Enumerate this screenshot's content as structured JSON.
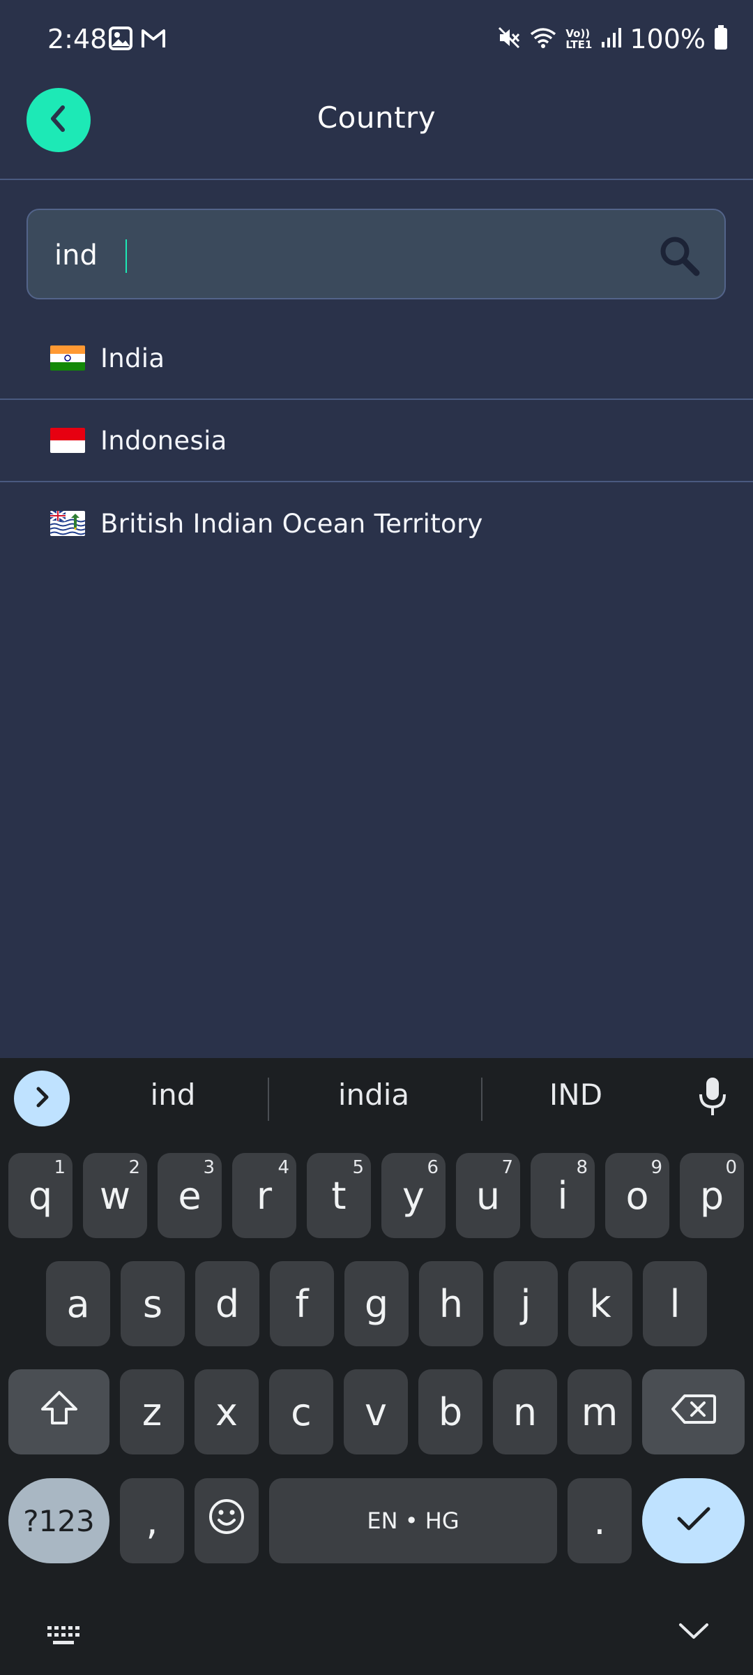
{
  "status_bar": {
    "time": "2:48",
    "battery": "100%",
    "network_label_top": "Vo))",
    "network_label_bottom": "LTE1"
  },
  "header": {
    "title": "Country",
    "accent": "#1de9b6"
  },
  "search": {
    "value": "ind",
    "placeholder": ""
  },
  "results": [
    {
      "label": "India",
      "flag": "flag-india-icon"
    },
    {
      "label": "Indonesia",
      "flag": "flag-indonesia-icon"
    },
    {
      "label": "British Indian Ocean Territory",
      "flag": "flag-british-indian-ocean-territory-icon"
    }
  ],
  "keyboard": {
    "suggestions": [
      "ind",
      "india",
      "IND"
    ],
    "row1": [
      {
        "key": "q",
        "hint": "1"
      },
      {
        "key": "w",
        "hint": "2"
      },
      {
        "key": "e",
        "hint": "3"
      },
      {
        "key": "r",
        "hint": "4"
      },
      {
        "key": "t",
        "hint": "5"
      },
      {
        "key": "y",
        "hint": "6"
      },
      {
        "key": "u",
        "hint": "7"
      },
      {
        "key": "i",
        "hint": "8"
      },
      {
        "key": "o",
        "hint": "9"
      },
      {
        "key": "p",
        "hint": "0"
      }
    ],
    "row2": [
      "a",
      "s",
      "d",
      "f",
      "g",
      "h",
      "j",
      "k",
      "l"
    ],
    "row3": [
      "z",
      "x",
      "c",
      "v",
      "b",
      "n",
      "m"
    ],
    "symbols_label": "?123",
    "comma_label": ",",
    "space_label": "EN • HG",
    "period_label": "."
  },
  "colors": {
    "background": "#2a324a",
    "search_bg": "#3b4a5c",
    "keyboard_bg": "#1c1f22",
    "key_bg": "#3c3f43",
    "enter_bg": "#bfe2ff"
  }
}
